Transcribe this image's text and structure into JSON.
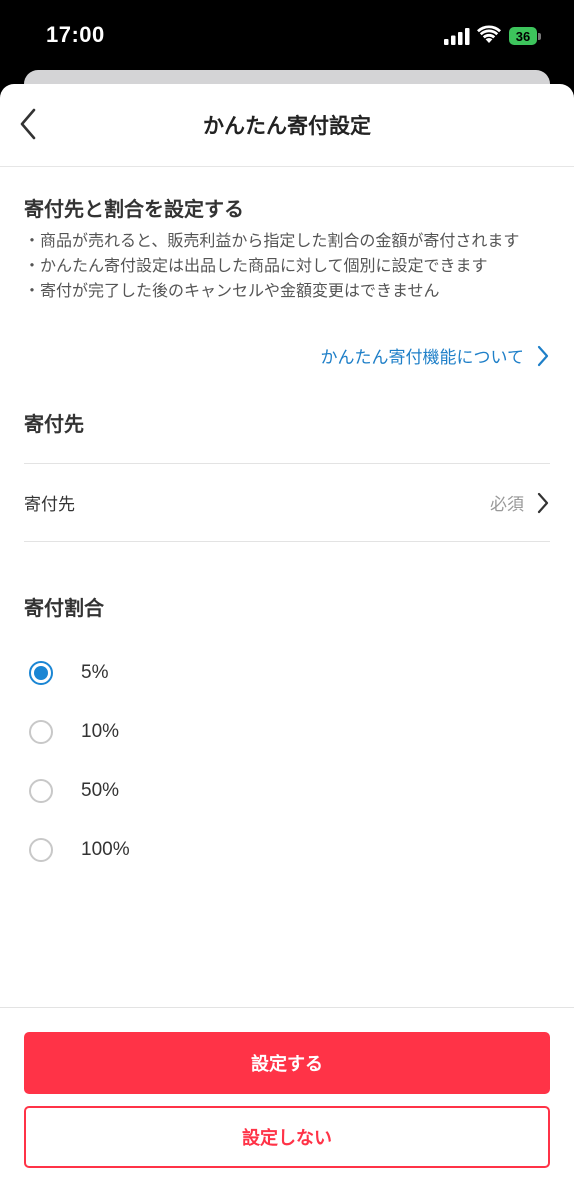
{
  "status_bar": {
    "time": "17:00",
    "battery": "36"
  },
  "nav": {
    "title": "かんたん寄付設定"
  },
  "intro": {
    "title": "寄付先と割合を設定する",
    "notes": [
      "・商品が売れると、販売利益から指定した割合の金額が寄付されます",
      "・かんたん寄付設定は出品した商品に対して個別に設定できます",
      "・寄付が完了した後のキャンセルや金額変更はできません"
    ],
    "about_link": "かんたん寄付機能について"
  },
  "destination": {
    "heading": "寄付先",
    "row_label": "寄付先",
    "row_status": "必須"
  },
  "ratio": {
    "heading": "寄付割合",
    "options": [
      {
        "label": "5%",
        "selected": true
      },
      {
        "label": "10%",
        "selected": false
      },
      {
        "label": "50%",
        "selected": false
      },
      {
        "label": "100%",
        "selected": false
      }
    ]
  },
  "footer": {
    "primary_label": "設定する",
    "secondary_label": "設定しない"
  },
  "colors": {
    "accent_red": "#ff3347",
    "link_blue": "#1e7fc8",
    "radio_blue": "#1a86d4",
    "battery_green": "#3dc45c"
  }
}
